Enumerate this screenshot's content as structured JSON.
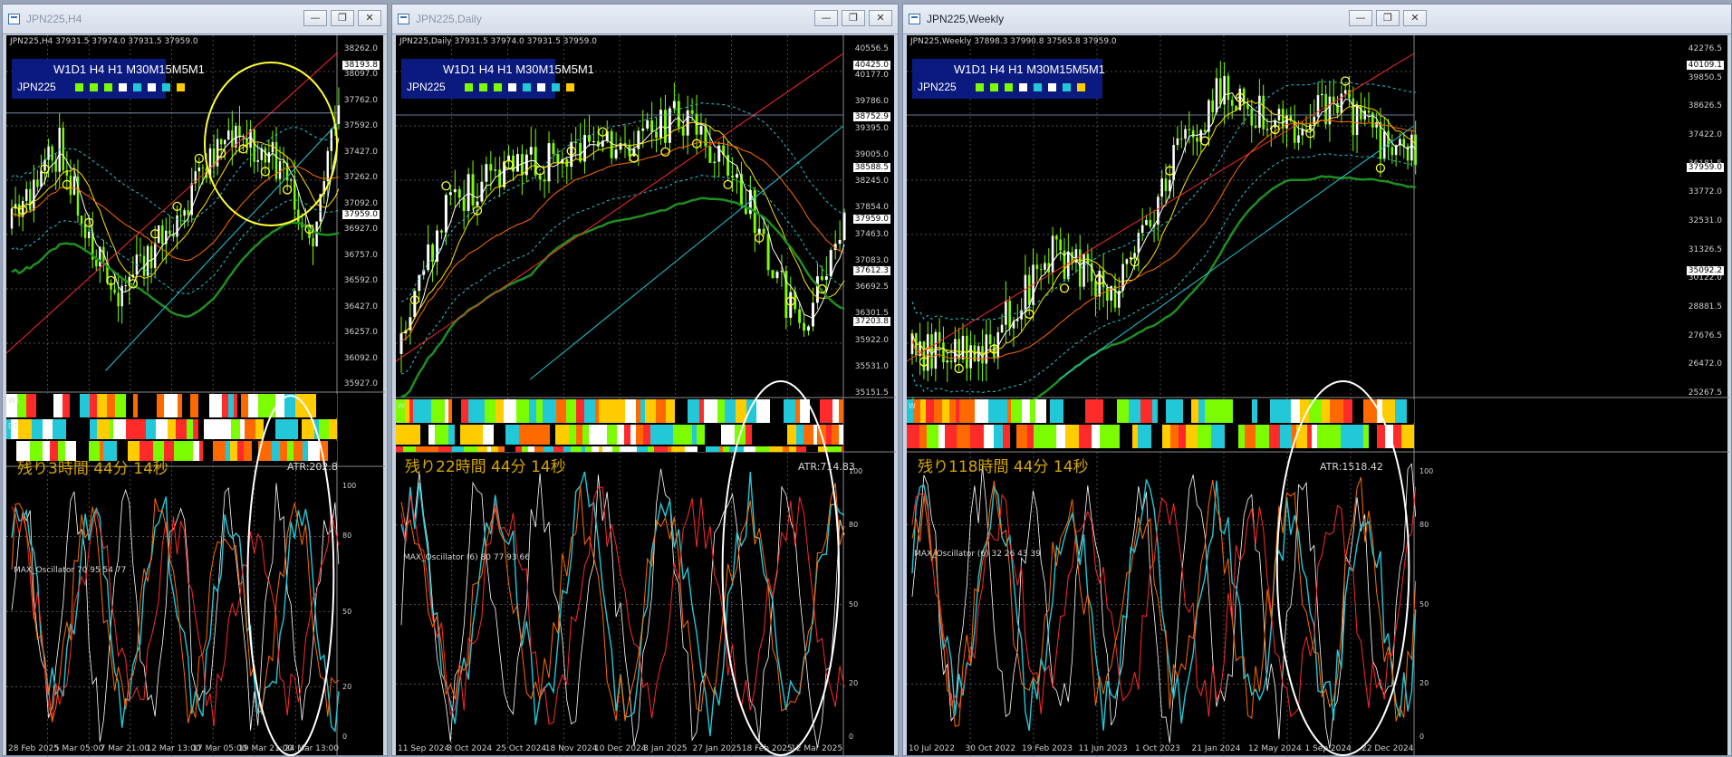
{
  "windows": [
    {
      "title": "JPN225,H4",
      "header_text": "JPN225,H4  37931.5 37974.0 37931.5 37959.0",
      "tf_labels": "W1D1 H4 H1 M30M15M5M1",
      "tf_symbol": "JPN225",
      "remaining": "残り3時間 44分 14秒",
      "atr": "ATR:202.8",
      "osc_label": "MAX_Oscillator 70 95 54 77",
      "price_labels": [
        "38262.0",
        "38097.0",
        "37762.0",
        "37592.0",
        "37427.0",
        "37262.0",
        "37092.0",
        "36927.0",
        "36757.0",
        "36592.0",
        "36427.0",
        "36257.0",
        "36092.0",
        "35927.0"
      ],
      "price_tags": [
        "38193.8",
        "37959.0"
      ],
      "date_labels": [
        "28 Feb 2025",
        "5 Mar 05:00",
        "7 Mar 21:00",
        "12 Mar 13:00",
        "17 Mar 05:00",
        "19 Mar 21:00",
        "24 Mar 13:00"
      ],
      "strip_labels": [
        "W1",
        "D1",
        ""
      ],
      "strip_scale": [
        "1",
        "0",
        "1",
        "0",
        "1",
        "0"
      ],
      "osc_scale": [
        "100",
        "80",
        "50",
        "20",
        "0"
      ],
      "active": false
    },
    {
      "title": "JPN225,Daily",
      "header_text": "JPN225,Daily  37931.5 37974.0 37931.5 37959.0",
      "tf_labels": "W1D1 H4 H1 M30M15M5M1",
      "tf_symbol": "JPN225",
      "remaining": "残り22時間 44分 14秒",
      "atr": "ATR:714.83",
      "osc_label": "MAX_Oscillator (6) 80 77 93 66",
      "price_labels": [
        "40556.5",
        "40177.0",
        "39786.0",
        "39395.0",
        "39005.0",
        "38245.0",
        "37854.0",
        "37463.0",
        "37083.0",
        "36692.5",
        "36301.5",
        "35922.0",
        "35531.0",
        "35151.5"
      ],
      "price_tags": [
        "40425.0",
        "38752.9",
        "38588.5",
        "37959.0",
        "37612.3",
        "37203.8"
      ],
      "date_labels": [
        "11 Sep 2024",
        "3 Oct 2024",
        "25 Oct 2024",
        "18 Nov 2024",
        "10 Dec 2024",
        "3 Jan 2025",
        "27 Jan 2025",
        "18 Feb 2025",
        "12 Mar 2025"
      ],
      "strip_labels": [
        "W",
        "",
        ""
      ],
      "strip_scale": [
        "1",
        "0",
        "1",
        "0"
      ],
      "osc_scale": [
        "100",
        "80",
        "50",
        "20",
        "0"
      ],
      "active": false
    },
    {
      "title": "JPN225,Weekly",
      "header_text": "JPN225,Weekly  37898.3 37990.8 37565.8 37959.0",
      "tf_labels": "W1D1 H4 H1 M30M15M5M1",
      "tf_symbol": "JPN225",
      "remaining": "残り118時間 44分 14秒",
      "atr": "ATR:1518.42",
      "osc_label": "MAX_Oscillator (6) 32 26 43 39",
      "price_labels": [
        "42276.5",
        "39850.5",
        "38626.5",
        "37422.0",
        "36181.5",
        "33772.0",
        "32531.0",
        "31326.5",
        "30122.0",
        "28881.5",
        "27676.5",
        "26472.0",
        "25267.5"
      ],
      "price_tags": [
        "40109.1",
        "37959.0",
        "35092.2"
      ],
      "date_labels": [
        "10 Jul 2022",
        "30 Oct 2022",
        "19 Feb 2023",
        "11 Jun 2023",
        "1 Oct 2023",
        "21 Jan 2024",
        "12 May 2024",
        "1 Sep 2024",
        "22 Dec 2024"
      ],
      "strip_labels": [
        "W",
        "",
        ""
      ],
      "strip_scale": [
        "1",
        "0",
        "1",
        "0"
      ],
      "osc_scale": [
        "100",
        "80",
        "50",
        "20",
        "0"
      ],
      "active": true
    }
  ],
  "colors": {
    "candle": "#7cfc00",
    "candle_white": "#ffffff",
    "red": "#ff2a2a",
    "cyan": "#22c8d8",
    "yellow": "#ffe100",
    "orange": "#ff6a00",
    "brown": "#8b3a2a",
    "green": "#1f8f1f",
    "annotation_yellow": "#ffff33",
    "annotation_white": "#ffffff"
  },
  "tf_square_colors": [
    "#7cfc00",
    "#7cfc00",
    "#7cfc00",
    "#ffffff",
    "#22c8d8",
    "#ffffff",
    "#22c8d8",
    "#ffcc00"
  ]
}
